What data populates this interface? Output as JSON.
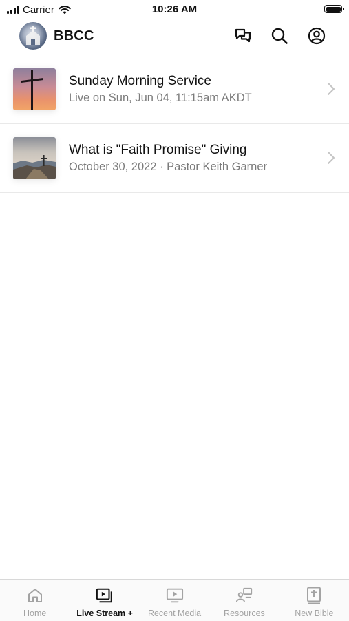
{
  "status_bar": {
    "carrier": "Carrier",
    "time": "10:26 AM",
    "signal_bars": 4,
    "battery_level": 1.0
  },
  "header": {
    "title": "BBCC",
    "icons": [
      "chat-icon",
      "search-icon",
      "profile-icon"
    ]
  },
  "media_items": [
    {
      "title": "Sunday Morning Service",
      "subtitle": "Live on Sun, Jun 04, 11:15am AKDT",
      "thumbnail": "cross-sunset-thumbnail"
    },
    {
      "title": "What is \"Faith Promise\" Giving",
      "subtitle": "October 30, 2022 · Pastor Keith Garner",
      "thumbnail": "mountain-cross-thumbnail"
    }
  ],
  "tabs": [
    {
      "label": "Home",
      "icon": "home-icon",
      "active": false
    },
    {
      "label": "Live Stream +",
      "icon": "live-stream-icon",
      "active": true
    },
    {
      "label": "Recent Media",
      "icon": "play-screen-icon",
      "active": false
    },
    {
      "label": "Resources",
      "icon": "resources-icon",
      "active": false
    },
    {
      "label": "New Bible",
      "icon": "bible-icon",
      "active": false
    }
  ],
  "colors": {
    "text_primary": "#111111",
    "text_secondary": "#7b7b7b",
    "tab_inactive": "#a3a3a3",
    "divider": "#e9e9e9",
    "chevron": "#c4c4c4"
  }
}
